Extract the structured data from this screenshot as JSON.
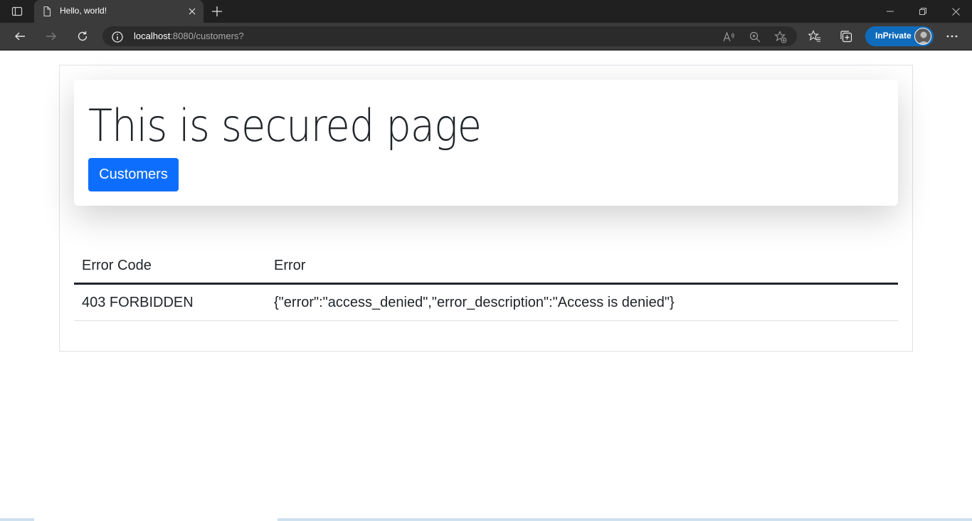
{
  "browser": {
    "tab": {
      "title": "Hello, world!"
    },
    "address": {
      "host": "localhost",
      "rest": ":8080/customers?"
    },
    "profile": {
      "label": "InPrivate"
    },
    "colors": {
      "accent": "#0f6cbd",
      "tab_bg": "#3b3b3b",
      "titlebar_bg": "#202020"
    }
  },
  "page": {
    "title": "This is secured page",
    "customers_button": "Customers",
    "table": {
      "headers": [
        "Error Code",
        "Error"
      ],
      "rows": [
        [
          "403 FORBIDDEN",
          "{\"error\":\"access_denied\",\"error_description\":\"Access is denied\"}"
        ]
      ]
    },
    "colors": {
      "primary_button": "#0d6efd",
      "text": "#212529"
    }
  }
}
